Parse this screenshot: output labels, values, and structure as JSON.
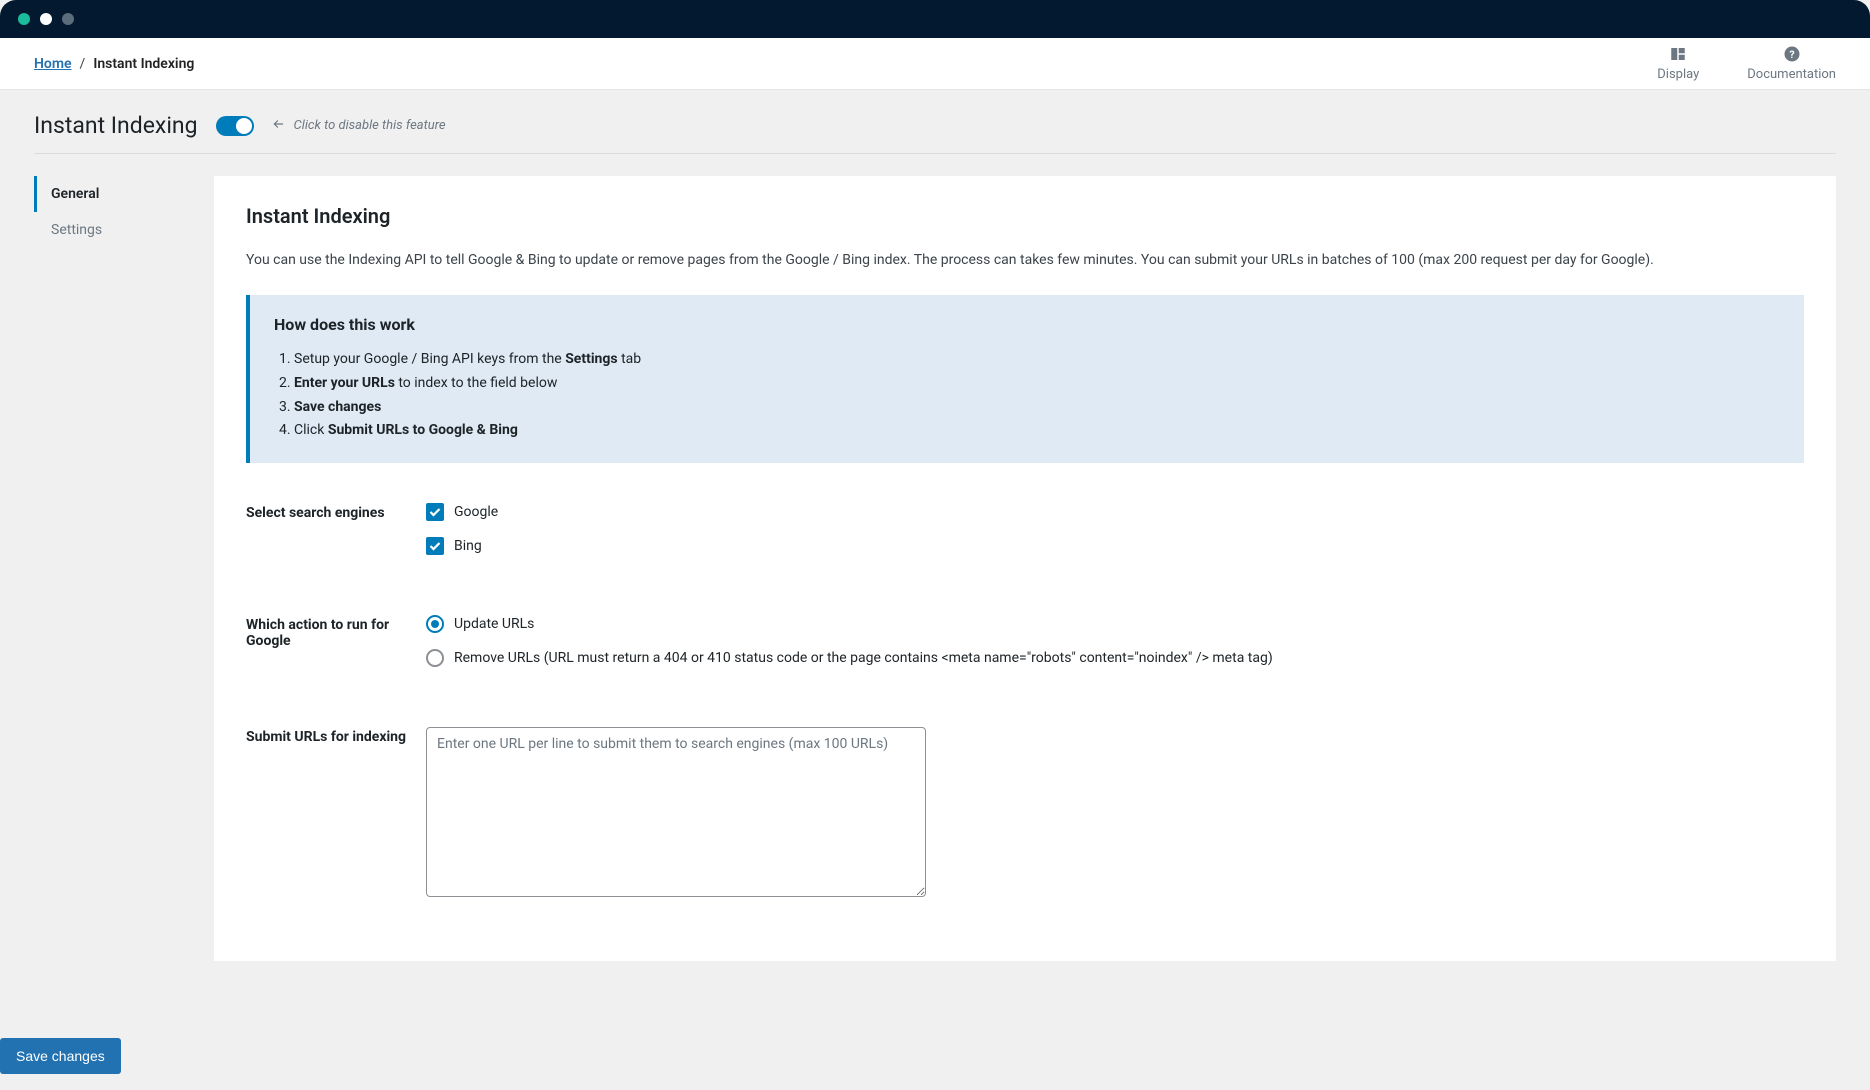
{
  "breadcrumb": {
    "home": "Home",
    "current": "Instant Indexing"
  },
  "quicklinks": {
    "display": "Display",
    "documentation": "Documentation"
  },
  "header": {
    "title": "Instant Indexing",
    "toggle_hint": "Click to disable this feature"
  },
  "subnav": {
    "general": "General",
    "settings": "Settings"
  },
  "panel": {
    "title": "Instant Indexing",
    "description": "You can use the Indexing API to tell Google & Bing to update or remove pages from the Google / Bing index. The process can takes few minutes. You can submit your URLs in batches of 100 (max 200 request per day for Google)."
  },
  "callout": {
    "title": "How does this work",
    "step1_a": "Setup your Google / Bing API keys from the ",
    "step1_b": "Settings",
    "step1_c": " tab",
    "step2_a": "Enter your URLs",
    "step2_b": " to index to the field below",
    "step3": "Save changes",
    "step4_a": "Click ",
    "step4_b": "Submit URLs to Google & Bing"
  },
  "form": {
    "engines_label": "Select search engines",
    "engine_google": "Google",
    "engine_bing": "Bing",
    "action_label": "Which action to run for Google",
    "action_update": "Update URLs",
    "action_remove": "Remove URLs (URL must return a 404 or 410 status code or the page contains <meta name=\"robots\" content=\"noindex\" /> meta tag)",
    "urls_label": "Submit URLs for indexing",
    "urls_placeholder": "Enter one URL per line to submit them to search engines (max 100 URLs)"
  },
  "buttons": {
    "save": "Save changes"
  }
}
